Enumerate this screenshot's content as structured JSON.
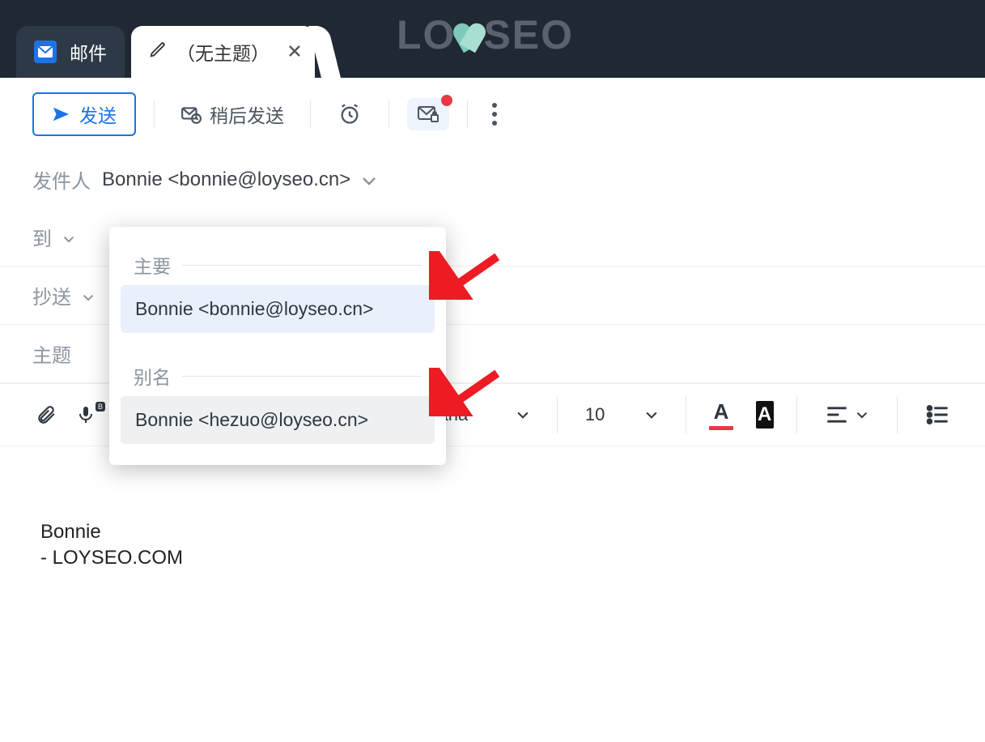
{
  "tabs": {
    "mail_label": "邮件",
    "compose_label": "（无主题）"
  },
  "watermark": {
    "pre": "LO",
    "post": "SEO"
  },
  "toolbar": {
    "send": "发送",
    "later": "稍后发送"
  },
  "fields": {
    "from_label": "发件人",
    "from_value": "Bonnie <bonnie@loyseo.cn>",
    "to_label": "到",
    "cc_label": "抄送",
    "subject_label": "主题"
  },
  "dropdown": {
    "primary_title": "主要",
    "primary_item": "Bonnie <bonnie@loyseo.cn>",
    "alias_title": "别名",
    "alias_item": "Bonnie <hezuo@loyseo.cn>"
  },
  "format": {
    "font": "rdana",
    "size": "10",
    "font_color_letter": "A",
    "highlight_letter": "A"
  },
  "body": "Bonnie\n- LOYSEO.COM"
}
